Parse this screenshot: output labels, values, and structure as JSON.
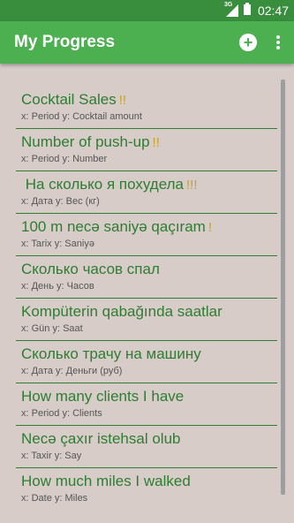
{
  "status_bar": {
    "network": "3G",
    "time": "02:47"
  },
  "app_bar": {
    "title": "My Progress"
  },
  "items": [
    {
      "name": "Cocktail Sales",
      "mark": "!!",
      "axes": "x: Period y: Cocktail amount"
    },
    {
      "name": "Number of push-up",
      "mark": "!!",
      "axes": "x: Period y: Number"
    },
    {
      "name": " На сколько я похудела",
      "mark": "!!!",
      "axes": "x: Дата y: Вес (кг)"
    },
    {
      "name": "100 m necə saniyə qaçıram",
      "mark": "!",
      "axes": "x: Tarix y: Saniyə"
    },
    {
      "name": "Сколько часов спал",
      "mark": "",
      "axes": "x: День y: Часов"
    },
    {
      "name": "Kompüterin qabağında saatlar",
      "mark": "",
      "axes": "x: Gün y: Saat"
    },
    {
      "name": "Сколько трачу на машину",
      "mark": "",
      "axes": "x: Дата y: Деньги (руб)"
    },
    {
      "name": "How many clients I have",
      "mark": "",
      "axes": "x: Period y: Clients"
    },
    {
      "name": "Necə çaxır istehsal olub",
      "mark": "",
      "axes": "x: Taxir y: Say"
    },
    {
      "name": "How much miles I walked",
      "mark": "",
      "axes": "x: Date y: Miles"
    }
  ]
}
